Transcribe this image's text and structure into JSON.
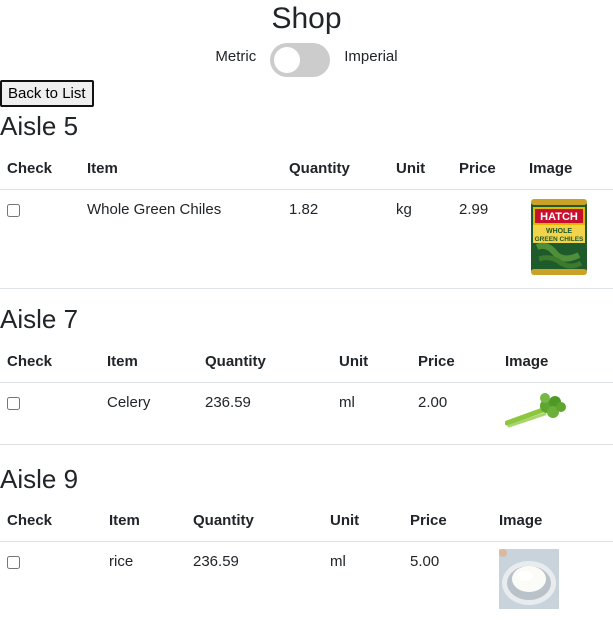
{
  "header": {
    "title": "Shop",
    "metric_label": "Metric",
    "imperial_label": "Imperial",
    "toggle_state": "metric"
  },
  "back_button": {
    "label": "Back to List"
  },
  "columns": {
    "check": "Check",
    "item": "Item",
    "quantity": "Quantity",
    "unit": "Unit",
    "price": "Price",
    "image": "Image"
  },
  "aisles": [
    {
      "title": "Aisle 5",
      "rows": [
        {
          "item": "Whole Green Chiles",
          "quantity": "1.82",
          "unit": "kg",
          "price": "2.99",
          "checked": false,
          "image": "hatch-can-image",
          "image_text": {
            "brand": "HATCH",
            "line1": "WHOLE",
            "line2": "GREEN CHILES"
          }
        }
      ]
    },
    {
      "title": "Aisle 7",
      "rows": [
        {
          "item": "Celery",
          "quantity": "236.59",
          "unit": "ml",
          "price": "2.00",
          "checked": false,
          "image": "celery-image"
        }
      ]
    },
    {
      "title": "Aisle 9",
      "rows": [
        {
          "item": "rice",
          "quantity": "236.59",
          "unit": "ml",
          "price": "5.00",
          "checked": false,
          "image": "rice-bowl-image"
        }
      ]
    }
  ],
  "colors": {
    "toggle_track": "#cccccc",
    "divider": "#dee2e6",
    "text": "#212529"
  }
}
